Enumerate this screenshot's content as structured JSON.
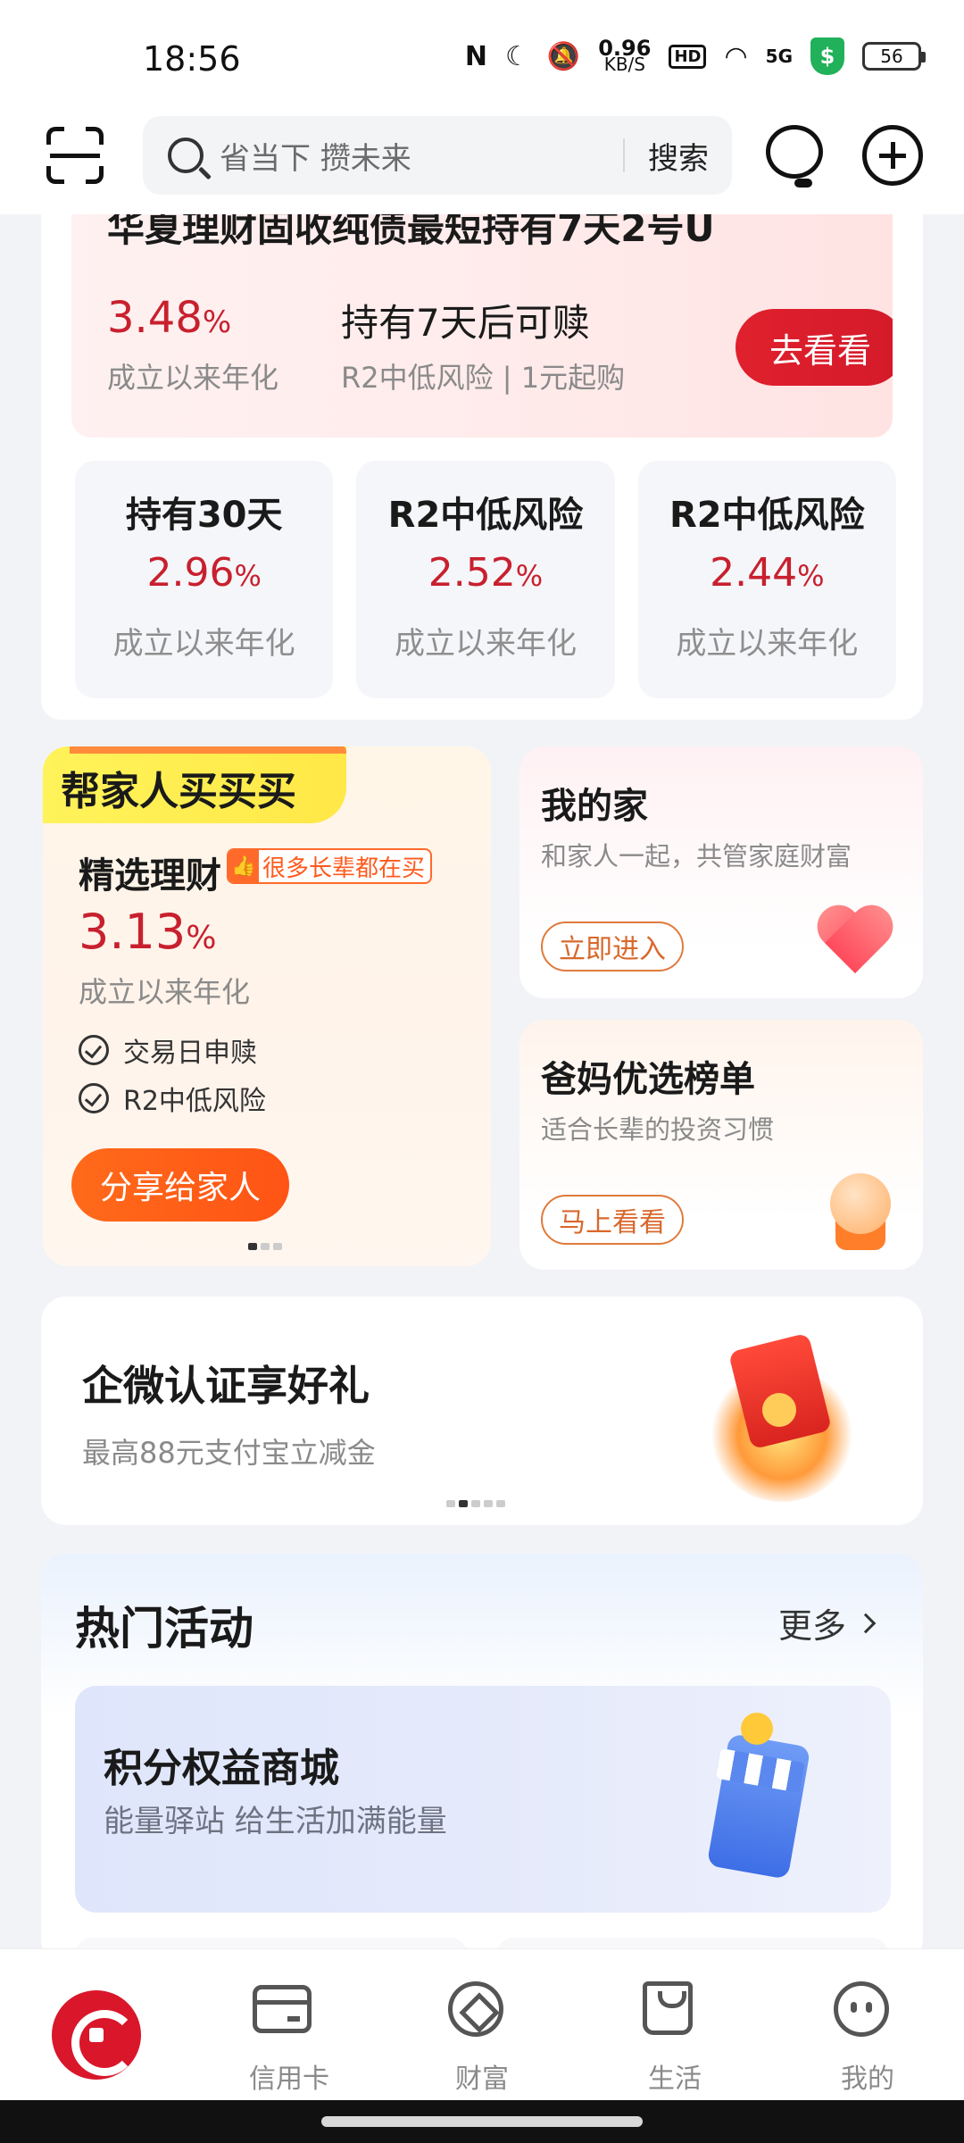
{
  "status_bar": {
    "time": "18:56",
    "nfc": "N",
    "net_speed_value": "0.96",
    "net_speed_unit": "KB/S",
    "hd": "HD",
    "signal": "5G",
    "shield": "$",
    "battery": "56"
  },
  "header": {
    "search_placeholder": "省当下 攒未来",
    "search_button": "搜索"
  },
  "featured_product": {
    "title": "华夏理财固收纯债最短持有7天2号U",
    "rate": "3.48",
    "rate_unit": "%",
    "rate_label": "成立以来年化",
    "hold_text": "持有7天后可赎",
    "risk_text": "R2中低风险 | 1元起购",
    "cta": "去看看"
  },
  "mini_products": [
    {
      "title": "持有30天",
      "rate": "2.96",
      "unit": "%",
      "label": "成立以来年化"
    },
    {
      "title": "R2中低风险",
      "rate": "2.52",
      "unit": "%",
      "label": "成立以来年化"
    },
    {
      "title": "R2中低风险",
      "rate": "2.44",
      "unit": "%",
      "label": "成立以来年化"
    }
  ],
  "family_card": {
    "tag": "帮家人买买买",
    "name": "精选理财",
    "badge": "很多长辈都在买",
    "rate": "3.13",
    "rate_unit": "%",
    "rate_label": "成立以来年化",
    "features": [
      "交易日申赎",
      "R2中低风险"
    ],
    "share_button": "分享给家人"
  },
  "my_home": {
    "title": "我的家",
    "subtitle": "和家人一起，共管家庭财富",
    "button": "立即进入"
  },
  "parents_pick": {
    "title": "爸妈优选榜单",
    "subtitle": "适合长辈的投资习惯",
    "button": "马上看看"
  },
  "promo": {
    "title": "企微认证享好礼",
    "subtitle": "最高88元支付宝立减金"
  },
  "hot_activities": {
    "title": "热门活动",
    "more": "更多",
    "mall_title": "积分权益商城",
    "mall_subtitle": "能量驿站 给生活加满能量"
  },
  "bottom_nav": {
    "items": [
      "信用卡",
      "财富",
      "生活",
      "我的"
    ]
  },
  "colors": {
    "accent_red": "#c8202e",
    "button_red": "#e0202d",
    "orange": "#ff5a1c"
  }
}
